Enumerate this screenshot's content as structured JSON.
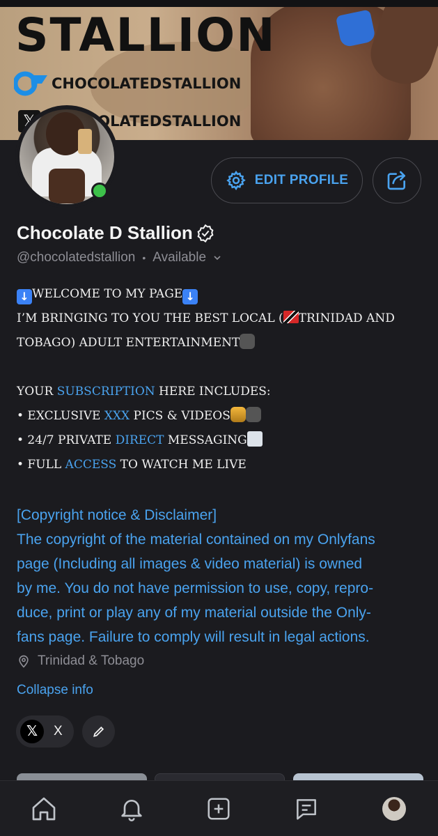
{
  "banner": {
    "brand": "STALLION",
    "onlyfans_handle": "CHOCOLATEDSTALLION",
    "x_handle": "CHOCOLATEDSTALLION"
  },
  "profile": {
    "display_name": "Chocolate D Stallion",
    "username": "@chocolatedstallion",
    "separator": "•",
    "status": "Available",
    "online": true
  },
  "actions": {
    "edit_label": "EDIT PROFILE"
  },
  "bio": {
    "welcome": "WELCOME TO MY PAGE",
    "intro_a": "I’M BRINGING TO YOU THE BEST LOCAL (",
    "intro_b": "TRINIDAD AND",
    "intro_c": "TOBAGO) ADULT ENTERTAINMENT",
    "sub_a": "YOUR ",
    "sub_link": "SUBSCRIPTION",
    "sub_b": " HERE INCLUDES:",
    "b1_a": "• EXCLUSIVE ",
    "b1_link": "XXX",
    "b1_b": " PICS & VIDEOS",
    "b2_a": "• 24/7 PRIVATE ",
    "b2_link": "DIRECT",
    "b2_b": " MESSAGING",
    "b3_a": "• FULL ",
    "b3_link": "ACCESS",
    "b3_b": " TO WATCH ME LIVE"
  },
  "copyright": {
    "lines": [
      "[Copyright notice & Disclaimer]",
      "The copyright of the material contained on my Onlyfans",
      "page (Including all images & video material) is owned",
      "by me. You do not have permission to use, copy, repro-",
      "duce, print or play any of my material outside the Only-",
      "fans page. Failure to comply will result in legal actions."
    ]
  },
  "location": "Trinidad & Tobago",
  "collapse_label": "Collapse info",
  "socials": {
    "x_label": "X"
  },
  "colors": {
    "accent": "#4aa3ef",
    "background": "#1b1b1f",
    "muted": "#8e8e95",
    "online": "#3dc14a"
  },
  "nav": {
    "icons": [
      "home-icon",
      "bell-icon",
      "add-post-icon",
      "messages-icon",
      "profile-avatar"
    ]
  }
}
